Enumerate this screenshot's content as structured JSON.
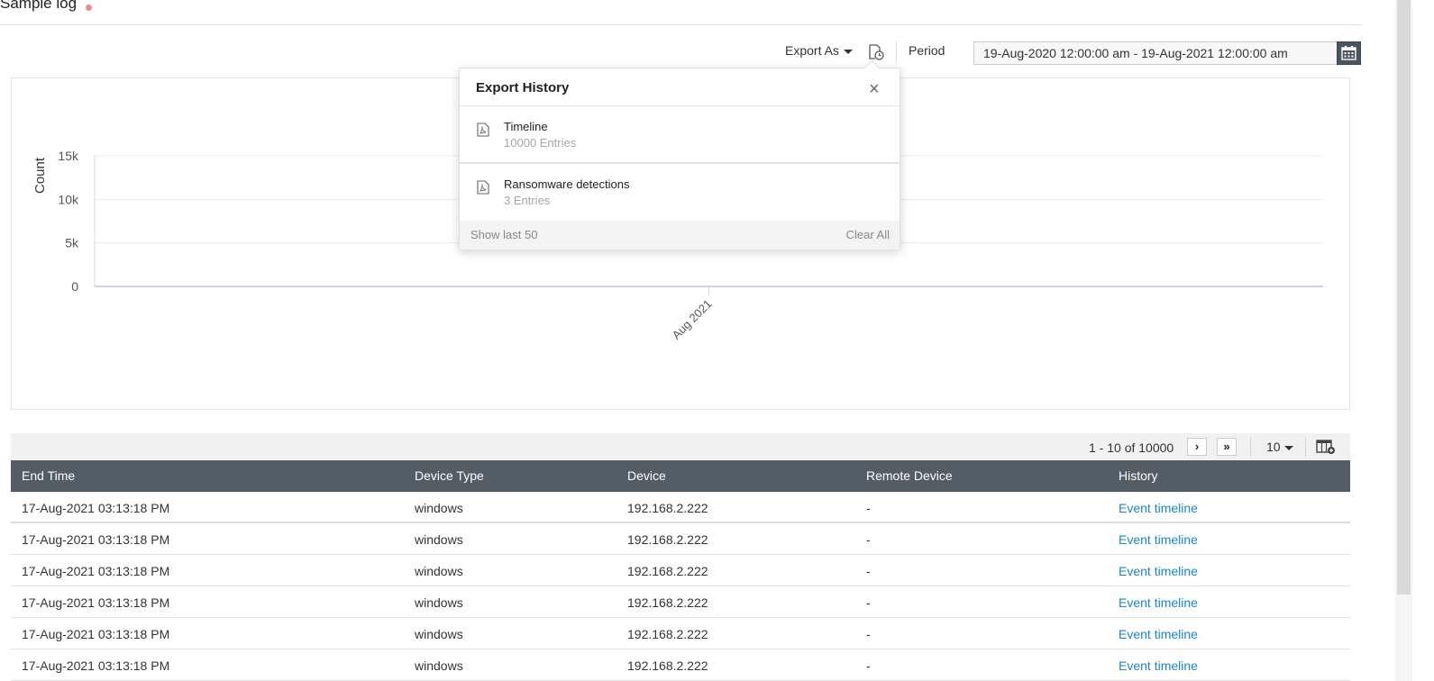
{
  "page": {
    "title": "Sample log",
    "title_dot_color": "#f08a8a"
  },
  "toolbar": {
    "export_as_label": "Export As",
    "export_history_icon": "export-history-icon",
    "period_label": "Period",
    "period_value": "19-Aug-2020 12:00:00 am - 19-Aug-2021 12:00:00 am",
    "calendar_icon": "calendar-icon"
  },
  "export_history": {
    "title": "Export History",
    "close_icon": "close-icon",
    "items": [
      {
        "name": "Timeline",
        "count": "10000 Entries",
        "icon": "pdf-file-icon"
      },
      {
        "name": "Ransomware detections",
        "count": "3 Entries",
        "icon": "pdf-file-icon"
      }
    ],
    "show_last_label": "Show last 50",
    "clear_all_label": "Clear All"
  },
  "chart_data": {
    "type": "bar",
    "categories": [
      "Aug 2021"
    ],
    "values": [
      0
    ],
    "title": "",
    "xlabel": "",
    "ylabel": "Count",
    "ylim": [
      0,
      15000
    ],
    "yticks": [
      "0",
      "5k",
      "10k",
      "15k"
    ],
    "grid": true
  },
  "pager": {
    "range_text": "1 - 10 of 10000",
    "next_label": "›",
    "last_label": "»",
    "page_size": "10",
    "column_chooser_icon": "column-chooser-icon"
  },
  "table": {
    "columns": [
      "End Time",
      "Device Type",
      "Device",
      "Remote Device",
      "History"
    ],
    "rows": [
      [
        "17-Aug-2021 03:13:18 PM",
        "windows",
        "192.168.2.222",
        "-",
        "Event timeline"
      ],
      [
        "17-Aug-2021 03:13:18 PM",
        "windows",
        "192.168.2.222",
        "-",
        "Event timeline"
      ],
      [
        "17-Aug-2021 03:13:18 PM",
        "windows",
        "192.168.2.222",
        "-",
        "Event timeline"
      ],
      [
        "17-Aug-2021 03:13:18 PM",
        "windows",
        "192.168.2.222",
        "-",
        "Event timeline"
      ],
      [
        "17-Aug-2021 03:13:18 PM",
        "windows",
        "192.168.2.222",
        "-",
        "Event timeline"
      ],
      [
        "17-Aug-2021 03:13:18 PM",
        "windows",
        "192.168.2.222",
        "-",
        "Event timeline"
      ]
    ]
  },
  "colors": {
    "header_bg": "#535d66",
    "link": "#1a86c8",
    "calendar_bg": "#4a5560"
  }
}
